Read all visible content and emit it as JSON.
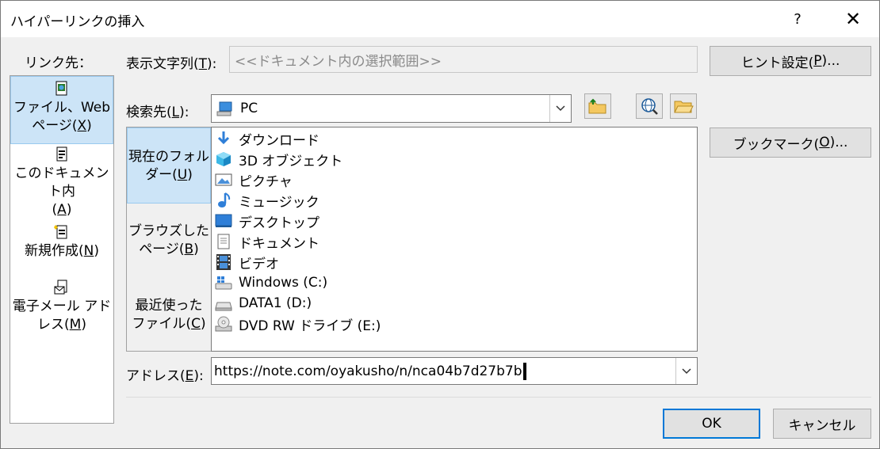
{
  "window": {
    "title": "ハイパーリンクの挿入",
    "help_label": "?",
    "close_label": "✕"
  },
  "link_to": {
    "label": "リンク先：",
    "items": [
      {
        "label_top": "ファイル、Web",
        "label_bottom_prefix": "ページ(",
        "label_key": "X",
        "label_suffix": ")",
        "selected": true
      },
      {
        "label_top": "このドキュメント内",
        "label_bottom_prefix": "(",
        "label_key": "A",
        "label_suffix": ")",
        "selected": false
      },
      {
        "label_top": "新規作成(",
        "label_key": "N",
        "label_suffix": ")",
        "selected": false
      },
      {
        "label_top": "電子メール アド",
        "label_bottom_prefix": "レス(",
        "label_key": "M",
        "label_suffix": ")",
        "selected": false
      }
    ]
  },
  "display_text": {
    "label_prefix": "表示文字列(",
    "label_key": "T",
    "label_suffix": "):",
    "value": "<<ドキュメント内の選択範囲>>"
  },
  "screentip_button": {
    "prefix": "ヒント設定(",
    "key": "P",
    "suffix": ")..."
  },
  "look_in": {
    "label_prefix": "検索先(",
    "label_key": "L",
    "label_suffix": "):",
    "value": "PC"
  },
  "bookmark_button": {
    "prefix": "ブックマーク(",
    "key": "O",
    "suffix": ")..."
  },
  "scope_tabs": [
    {
      "line1": "現在のフォル",
      "line2_prefix": "ダー(",
      "key": "U",
      "suffix": ")",
      "active": true
    },
    {
      "line1": "ブラウズした",
      "line2_prefix": "ページ(",
      "key": "B",
      "suffix": ")",
      "active": false
    },
    {
      "line1": "最近使った",
      "line2_prefix": "ファイル(",
      "key": "C",
      "suffix": ")",
      "active": false
    }
  ],
  "files": [
    {
      "name": "ダウンロード",
      "icon": "download-arrow-icon"
    },
    {
      "name": "3D オブジェクト",
      "icon": "3d-objects-icon"
    },
    {
      "name": "ピクチャ",
      "icon": "pictures-icon"
    },
    {
      "name": "ミュージック",
      "icon": "music-note-icon"
    },
    {
      "name": "デスクトップ",
      "icon": "desktop-icon"
    },
    {
      "name": "ドキュメント",
      "icon": "documents-icon"
    },
    {
      "name": "ビデオ",
      "icon": "video-film-icon"
    },
    {
      "name": "Windows (C:)",
      "icon": "windows-drive-icon"
    },
    {
      "name": "DATA1 (D:)",
      "icon": "drive-icon"
    },
    {
      "name": "DVD RW ドライブ (E:)",
      "icon": "dvd-drive-icon"
    }
  ],
  "address": {
    "label_prefix": "アドレス(",
    "label_key": "E",
    "label_suffix": "):",
    "value": "https://note.com/oyakusho/n/nca04b7d27b7b"
  },
  "ok_button": {
    "label": "OK"
  },
  "cancel_button": {
    "label": "キャンセル"
  }
}
